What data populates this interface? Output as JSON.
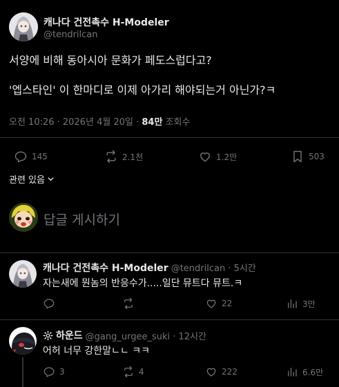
{
  "main_post": {
    "display_name": "캐나다 건전촉수 H-Modeler",
    "handle": "@tendrilcan",
    "text_line1": "서양에 비해 동아시아 문화가 페도스럽다고?",
    "text_line2": "'엡스타인' 이 한마디로 이제 아가리 해야되는거 아닌가?ㅋ",
    "time": "오전 10:26 · 2026년 4월 20일 · ",
    "views_count": "84만",
    "views_label": " 조회수",
    "stats": {
      "replies": "145",
      "reposts": "2.1천",
      "likes": "1.2만",
      "bookmarks": "503"
    }
  },
  "related_label": "관련 있음",
  "reply_prompt": "답글 게시하기",
  "replies": [
    {
      "display_name": "캐나다 건전촉수 H-Modeler",
      "handle": "@tendrilcan · 5시간",
      "text": "자는새에 뭔놈의 반응수가.....일단 뮤트다 뮤트.ㅋ",
      "stats": {
        "replies": "",
        "reposts": "",
        "likes": "22",
        "views": "3만"
      }
    },
    {
      "display_name": "하운드",
      "handle": "@gang_urgee_suki · 12시간",
      "text": "어허 너무 강한말ㄴㄴ ㅋㅋ",
      "stats": {
        "replies": "3",
        "reposts": "4",
        "likes": "222",
        "views": "6.6만"
      }
    }
  ],
  "colors": {
    "background": "#000000",
    "text": "#e7e9ea",
    "muted": "#71767b",
    "divider": "#2f3336"
  },
  "icons": [
    "reply-icon",
    "repost-icon",
    "like-icon",
    "bookmark-icon",
    "views-icon",
    "chevron-down-icon",
    "gear-icon"
  ]
}
